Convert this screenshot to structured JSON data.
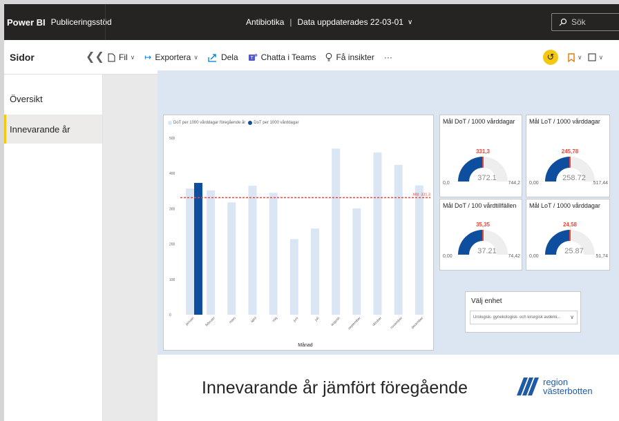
{
  "topbar": {
    "brand": "Power BI",
    "workspace": "Publiceringsstöd",
    "report_name": "Antibiotika",
    "separator": "|",
    "updated": "Data uppdaterades 22-03-01",
    "search_placeholder": "Sök"
  },
  "toolbar": {
    "pages_label": "Sidor",
    "file": "Fil",
    "export": "Exportera",
    "share": "Dela",
    "teams": "Chatta i Teams",
    "insights": "Få insikter",
    "more": "···"
  },
  "sidebar": {
    "items": [
      {
        "label": "Översikt",
        "active": false
      },
      {
        "label": "Innevarande år",
        "active": true
      }
    ]
  },
  "report": {
    "title": "Innevarande år jämfört föregående",
    "logo_line1": "region",
    "logo_line2": "västerbotten"
  },
  "chart_data": {
    "type": "bar",
    "legend": [
      "DoT per 1000 vårddagar föregående år",
      "DoT per 1000 vårddagar"
    ],
    "categories": [
      "januari",
      "februari",
      "mars",
      "april",
      "maj",
      "juni",
      "juli",
      "augusti",
      "september",
      "oktober",
      "november",
      "december"
    ],
    "series": [
      {
        "name": "DoT per 1000 vårddagar föregående år",
        "color": "#dbe6f5",
        "values": [
          357,
          352,
          318,
          365,
          345,
          214,
          244,
          470,
          301,
          459,
          424,
          366
        ]
      },
      {
        "name": "DoT per 1000 vårddagar",
        "color": "#0d4f9e",
        "values": [
          373,
          null,
          null,
          null,
          null,
          null,
          null,
          null,
          null,
          null,
          null,
          null
        ]
      }
    ],
    "target": {
      "label": "Mål: 331,3",
      "value": 331.3,
      "color": "#e8483b"
    },
    "xlabel": "Månad",
    "ylabel": "",
    "ylim": [
      0,
      500
    ],
    "yticks": [
      0,
      100,
      200,
      300,
      400,
      500
    ]
  },
  "gauges": [
    {
      "title": "Mål DoT / 1000 vårddagar",
      "target": "331,3",
      "value": "372.1",
      "min": "0,0",
      "max": "744,2",
      "fraction": 0.5
    },
    {
      "title": "Mål LoT / 1000 vårddagar",
      "target": "245,78",
      "value": "258.72",
      "min": "0,00",
      "max": "517,44",
      "fraction": 0.5
    },
    {
      "title": "Mål DoT / 100 vårdtillfällen",
      "target": "35,35",
      "value": "37.21",
      "min": "0,00",
      "max": "74,42",
      "fraction": 0.5
    },
    {
      "title": "Mål LoT / 1000 vårddagar",
      "target": "24,58",
      "value": "25.87",
      "min": "0,00",
      "max": "51,74",
      "fraction": 0.5
    }
  ],
  "slicer": {
    "label": "Välj enhet",
    "selected": "Urologisk- gynekologisk- och kirurgisk avdelni..."
  },
  "colors": {
    "accent": "#f2c811",
    "bar_dark": "#0d4f9e",
    "bar_light": "#dbe6f5",
    "target_line": "#e8483b",
    "gauge_fill": "#0d4f9e",
    "gauge_track": "#eeeeee"
  }
}
